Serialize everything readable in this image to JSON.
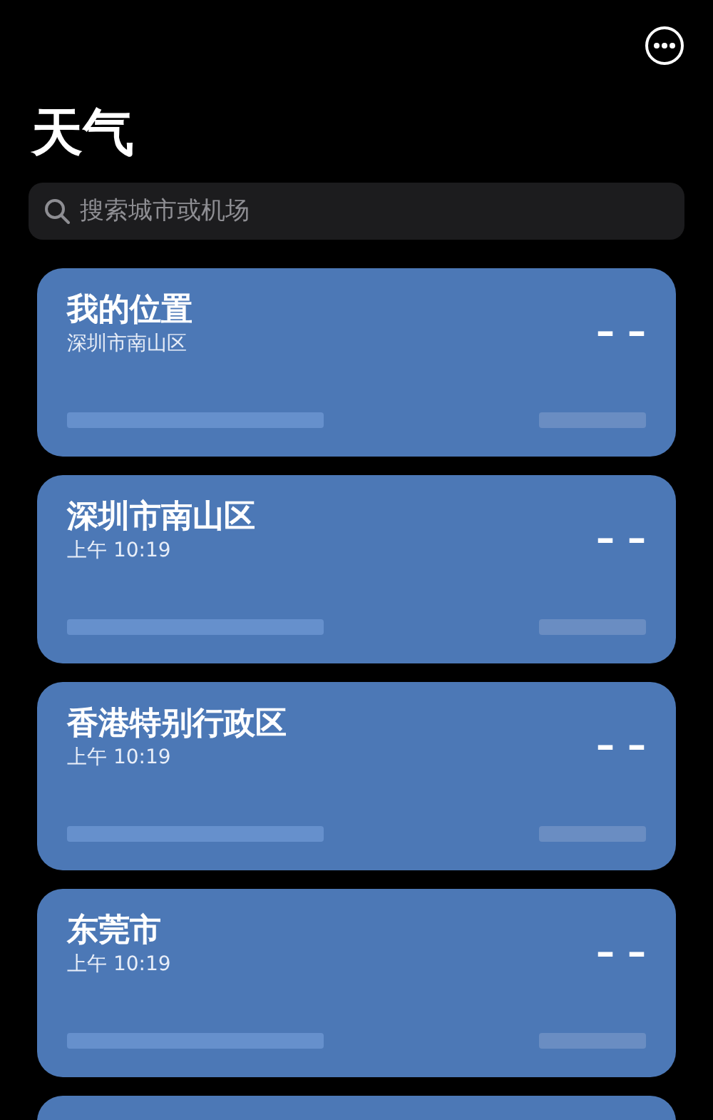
{
  "header": {
    "title": "天气"
  },
  "search": {
    "placeholder": "搜索城市或机场"
  },
  "cards": [
    {
      "kind": "full",
      "title": "我的位置",
      "subtitle": "深圳市南山区",
      "temperature": "– –"
    },
    {
      "kind": "full",
      "title": "深圳市南山区",
      "subtitle": "上午 10:19",
      "temperature": "– –"
    },
    {
      "kind": "full",
      "title": "香港特别行政区",
      "subtitle": "上午 10:19",
      "temperature": "– –"
    },
    {
      "kind": "full",
      "title": "东莞市",
      "subtitle": "上午 10:19",
      "temperature": "– –"
    },
    {
      "kind": "cut"
    }
  ]
}
